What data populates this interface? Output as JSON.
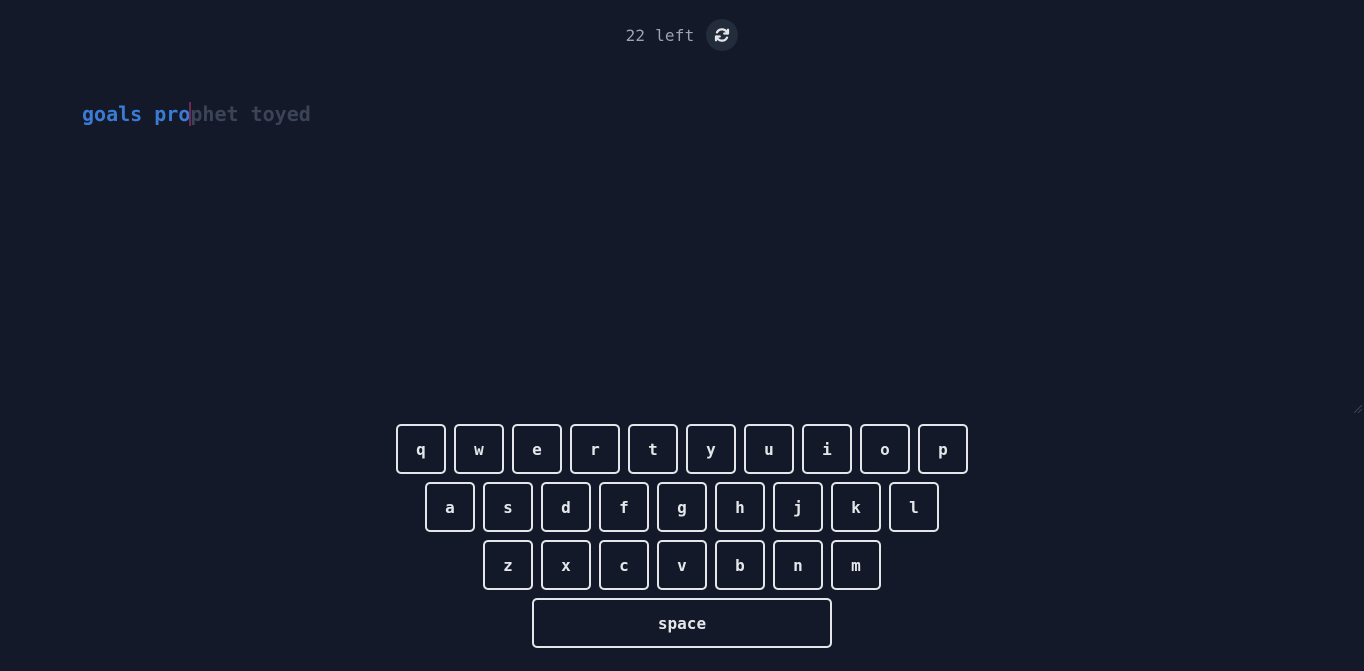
{
  "header": {
    "counter_text": "22 left",
    "reset_icon": "refresh-icon"
  },
  "text": {
    "typed": "goals pro",
    "remaining": "phet toyed"
  },
  "keyboard": {
    "row1": [
      "q",
      "w",
      "e",
      "r",
      "t",
      "y",
      "u",
      "i",
      "o",
      "p"
    ],
    "row2": [
      "a",
      "s",
      "d",
      "f",
      "g",
      "h",
      "j",
      "k",
      "l"
    ],
    "row3": [
      "z",
      "x",
      "c",
      "v",
      "b",
      "n",
      "m"
    ],
    "space_label": "space"
  },
  "colors": {
    "background": "#131928",
    "typed": "#3a7bd5",
    "pending": "#3b4456",
    "caret": "#6a2a55",
    "key_border": "#e4e6ea"
  }
}
